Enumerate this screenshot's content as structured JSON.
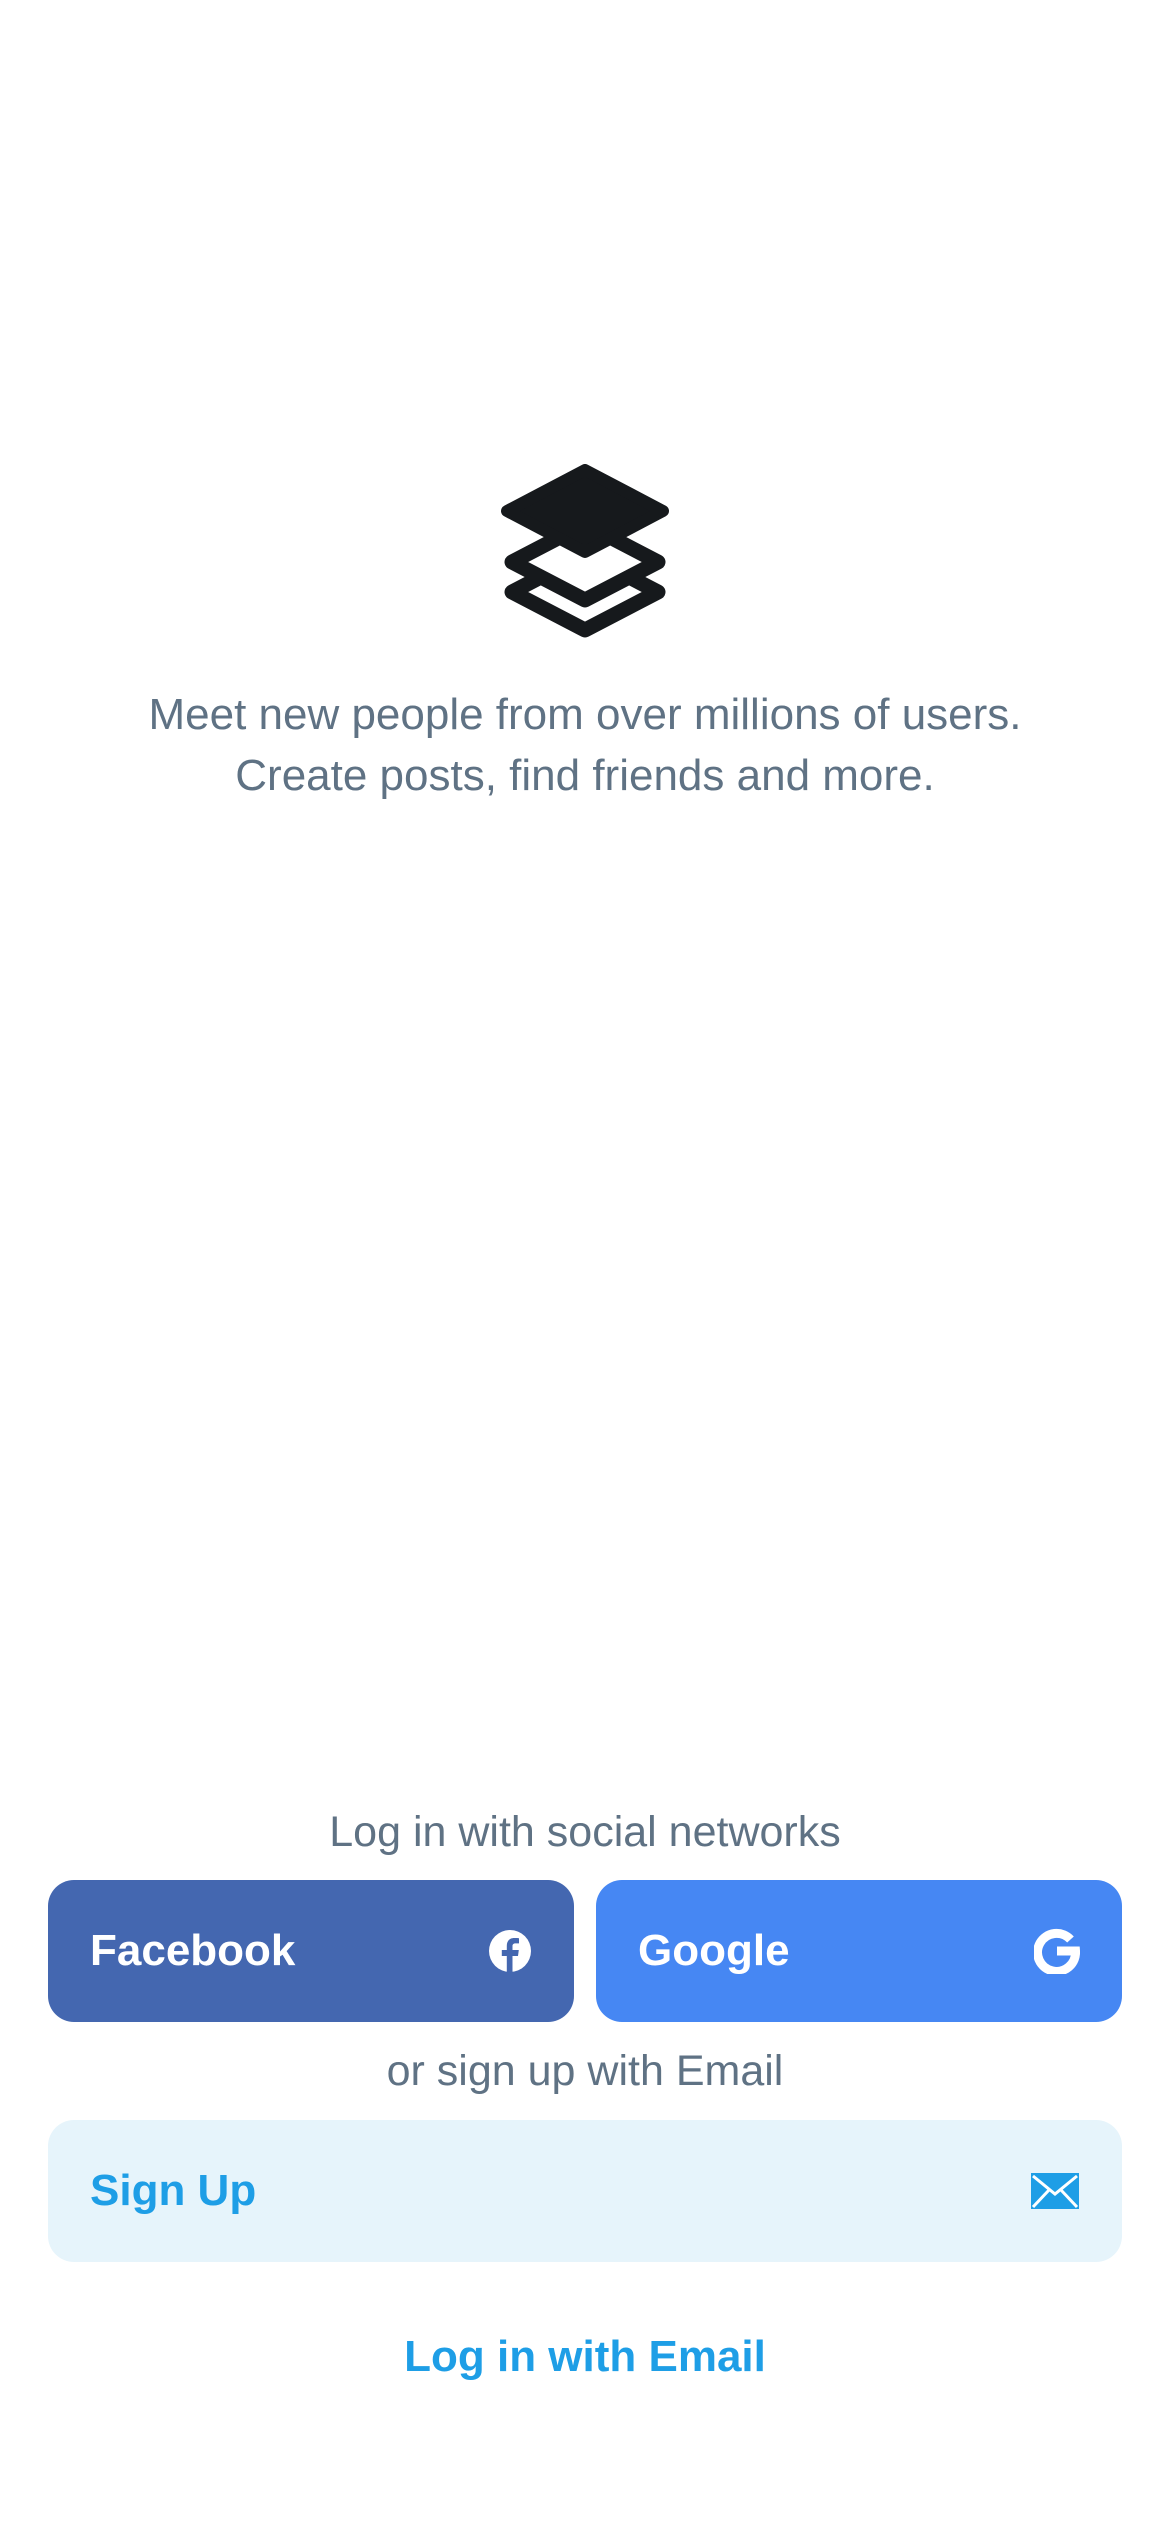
{
  "app": {
    "logo_icon": "layers-icon",
    "tagline": "Meet new people from over millions of users. Create posts, find friends and more."
  },
  "social": {
    "heading": "Log in with social networks",
    "facebook_label": "Facebook",
    "facebook_icon": "facebook-icon",
    "facebook_color": "#4467b0",
    "google_label": "Google",
    "google_icon": "google-icon",
    "google_color": "#4687f3"
  },
  "email": {
    "heading": "or sign up with Email",
    "signup_label": "Sign Up",
    "signup_icon": "mail-icon",
    "login_label": "Log in with Email",
    "accent_color": "#1e9ee6"
  }
}
